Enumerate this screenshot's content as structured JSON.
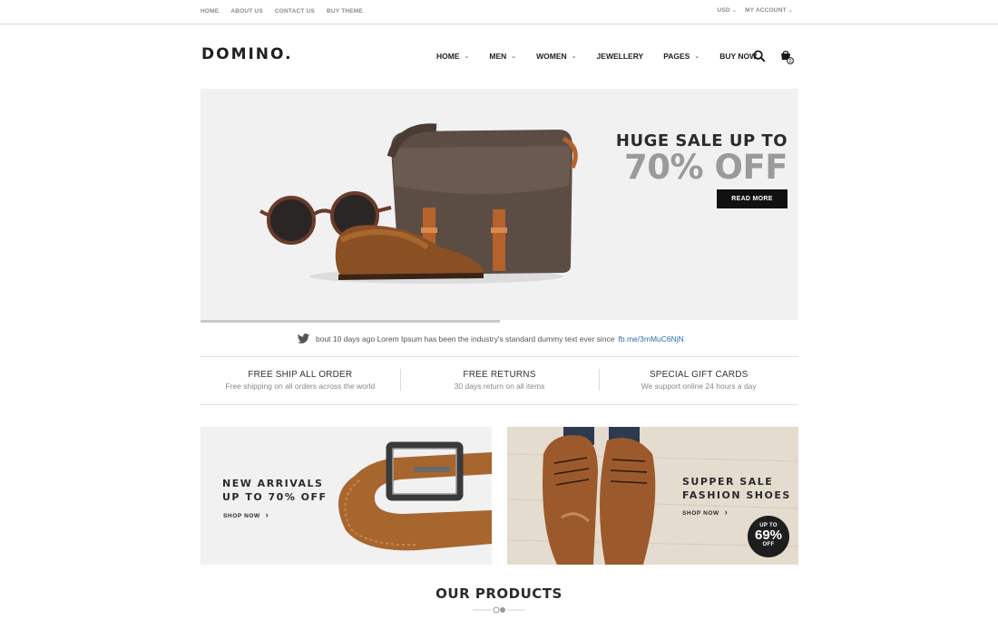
{
  "topbar": {
    "links": [
      "HOME",
      "ABOUT US",
      "CONTACT US",
      "BUY THEME"
    ],
    "currency": "USD",
    "account": "MY ACCOUNT"
  },
  "header": {
    "logo": "DOMINO.",
    "nav": [
      {
        "label": "HOME",
        "has_dropdown": true
      },
      {
        "label": "MEN",
        "has_dropdown": true
      },
      {
        "label": "WOMEN",
        "has_dropdown": true
      },
      {
        "label": "JEWELLERY",
        "has_dropdown": false
      },
      {
        "label": "PAGES",
        "has_dropdown": true
      },
      {
        "label": "BUY NOW",
        "has_dropdown": false
      }
    ],
    "search_icon": "search-icon",
    "cart_icon": "cart-icon",
    "cart_count": "0"
  },
  "hero": {
    "title": "HUGE SALE UP TO",
    "highlight": "70% OFF",
    "button": "READ MORE",
    "slide_progress": 0.5
  },
  "tweet": {
    "icon": "twitter-icon",
    "text": "bout 10 days ago Lorem Ipsum has been the industry's standard dummy text ever since",
    "link": "fb.me/3mMuC6NjN"
  },
  "features": [
    {
      "title": "FREE SHIP ALL ORDER",
      "subtitle": "Free shipping on all orders across the world"
    },
    {
      "title": "FREE RETURNS",
      "subtitle": "30 days return on all items"
    },
    {
      "title": "SPECIAL GIFT CARDS",
      "subtitle": "We support online 24 hours a day"
    }
  ],
  "promos": {
    "left": {
      "line1": "NEW ARRIVALS",
      "line2": "UP TO 70% OFF",
      "shop": "SHOP NOW"
    },
    "right": {
      "line1": "SUPPER SALE",
      "line2": "FASHION SHOES",
      "shop": "SHOP NOW",
      "badge_top": "UP TO",
      "badge_value": "69%",
      "badge_bottom": "OFF"
    }
  },
  "products": {
    "title": "OUR PRODUCTS"
  },
  "colors": {
    "accent": "#111111",
    "link": "#2a6fb0",
    "hero_bg": "#f1f1f1"
  }
}
